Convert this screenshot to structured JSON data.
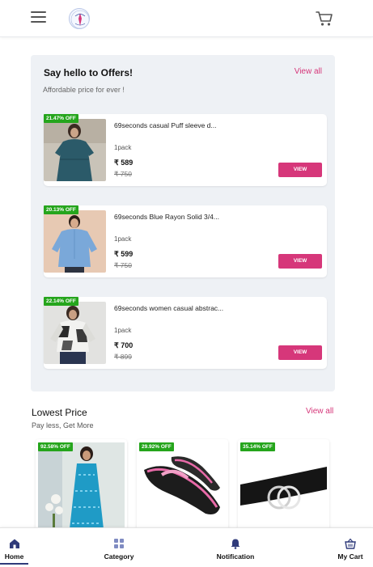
{
  "header": {
    "menu_icon": "hamburger-menu-icon",
    "logo_icon": "brand-logo",
    "cart_icon": "shopping-cart-icon"
  },
  "offers": {
    "title": "Say hello to Offers!",
    "subtitle": "Affordable price for ever !",
    "view_all": "View all",
    "items": [
      {
        "badge": "21.47% OFF",
        "name": "69seconds casual Puff sleeve d...",
        "pack": "1pack",
        "price": "₹ 589",
        "mrp": "₹ 750",
        "button": "VIEW"
      },
      {
        "badge": "20.13% OFF",
        "name": "69seconds Blue Rayon Solid 3/4...",
        "pack": "1pack",
        "price": "₹ 599",
        "mrp": "₹ 750",
        "button": "VIEW"
      },
      {
        "badge": "22.14% OFF",
        "name": "69seconds women casual abstrac...",
        "pack": "1pack",
        "price": "₹ 700",
        "mrp": "₹ 899",
        "button": "VIEW"
      }
    ]
  },
  "lowest": {
    "title": "Lowest Price",
    "subtitle": "Pay less, Get More",
    "view_all": "View all",
    "products": [
      {
        "badge": "92.58% OFF"
      },
      {
        "badge": "29.92% OFF"
      },
      {
        "badge": "35.14% OFF"
      }
    ]
  },
  "bottom_nav": {
    "items": [
      {
        "label": "Home",
        "icon": "home-icon",
        "active": true
      },
      {
        "label": "Category",
        "icon": "category-grid-icon",
        "active": false
      },
      {
        "label": "Notification",
        "icon": "bell-icon",
        "active": false
      },
      {
        "label": "My Cart",
        "icon": "basket-icon",
        "active": false
      }
    ]
  },
  "colors": {
    "accent": "#d6377a",
    "badge_green": "#25a51c",
    "nav_active": "#2f3a7a",
    "section_bg": "#eef1f5"
  }
}
